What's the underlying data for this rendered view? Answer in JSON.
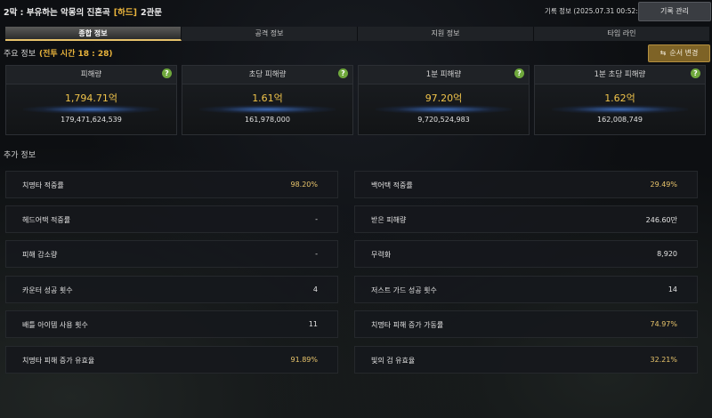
{
  "header": {
    "title_prefix": "2막 : 부유하는 악몽의 진혼곡",
    "difficulty": "[하드]",
    "gate": "2관문",
    "record_time": "기록 정보 (2025.07.31 00:52:50)",
    "record_manage_label": "기록 관리"
  },
  "tabs": [
    {
      "label": "종합 정보",
      "active": true
    },
    {
      "label": "공격 정보",
      "active": false
    },
    {
      "label": "지원 정보",
      "active": false
    },
    {
      "label": "타임 라인",
      "active": false
    }
  ],
  "main_info": {
    "label": "주요 정보",
    "battle_time": "(전투 시간 18 : 28)",
    "order_change_label": "순서 변경"
  },
  "cards": [
    {
      "title": "피해량",
      "value": "1,794.71억",
      "raw": "179,471,624,539"
    },
    {
      "title": "초당 피해량",
      "value": "1.61억",
      "raw": "161,978,000"
    },
    {
      "title": "1분 피해량",
      "value": "97.20억",
      "raw": "9,720,524,983"
    },
    {
      "title": "1분 초당 피해량",
      "value": "1.62억",
      "raw": "162,008,749"
    }
  ],
  "extra_info": {
    "label": "추가 정보",
    "left": [
      {
        "label": "치명타 적중률",
        "value": "98.20%",
        "gold": true
      },
      {
        "label": "헤드어택 적중률",
        "value": "-",
        "gold": false
      },
      {
        "label": "피해 감소량",
        "value": "-",
        "gold": false
      },
      {
        "label": "카운터 성공 횟수",
        "value": "4",
        "gold": false
      },
      {
        "label": "배틀 아이템 사용 횟수",
        "value": "11",
        "gold": false
      },
      {
        "label": "치명타 피해 증가 유효율",
        "value": "91.89%",
        "gold": true
      }
    ],
    "right": [
      {
        "label": "백어택 적중률",
        "value": "29.49%",
        "gold": true
      },
      {
        "label": "받은 피해량",
        "value": "246.60만",
        "gold": false
      },
      {
        "label": "무력화",
        "value": "8,920",
        "gold": false
      },
      {
        "label": "저스트 가드 성공 횟수",
        "value": "14",
        "gold": false
      },
      {
        "label": "치명타 피해 증가 가동률",
        "value": "74.97%",
        "gold": true
      },
      {
        "label": "빛의 검 유효율",
        "value": "32.21%",
        "gold": true
      }
    ]
  },
  "icons": {
    "help": "question-icon",
    "order": "swap-arrows-icon"
  },
  "colors": {
    "accent_gold": "#e8b33c",
    "help_green": "#6fa83c",
    "glow_blue": "#4682e6"
  }
}
